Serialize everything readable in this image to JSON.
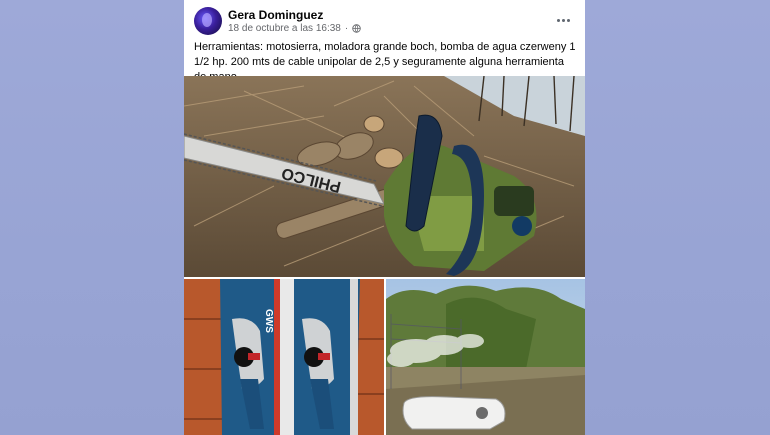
{
  "post": {
    "author": "Gera Dominguez",
    "timestamp": "18 de octubre a las 16:38",
    "separator": "·",
    "privacy_icon": "globe-icon",
    "more_icon": "more-horizontal-icon",
    "text": "Herramientas: motosierra, moladora grande boch, bomba de agua czerweny 1 1/2 hp. 200 mts de cable unipolar de 2,5 y seguramente alguna herramienta de mano"
  },
  "photos": {
    "main": {
      "chain_label": "PHILCO"
    },
    "bottom_left": {
      "box_label": "GWS"
    },
    "bottom_right": {}
  }
}
